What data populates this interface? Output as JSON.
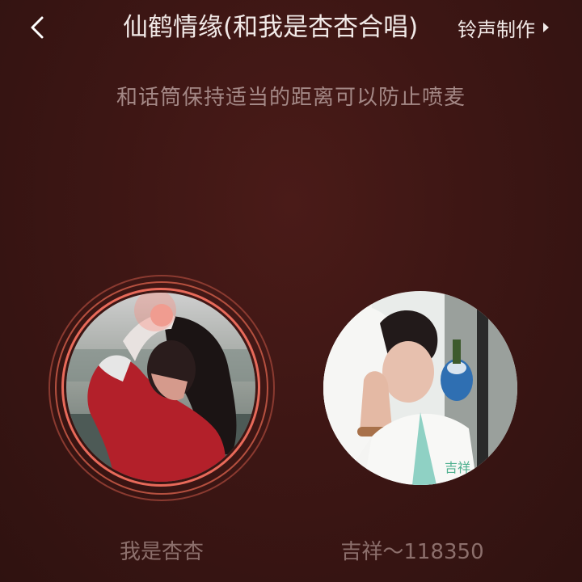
{
  "header": {
    "back_icon": "chevron-left-icon",
    "song_title": "仙鹤情缘(和我是杏杏合唱)",
    "ringtone_label": "铃声制作",
    "ringtone_icon": "triangle-right-icon"
  },
  "tip": "和话筒保持适当的距离可以防止喷麦",
  "singers": [
    {
      "name": "我是杏杏",
      "active": true
    },
    {
      "name": "吉祥～118350",
      "active": false,
      "photo_caption": "吉祥"
    }
  ],
  "colors": {
    "ring": "#c85a4c",
    "accent": "#e86a5a",
    "background": "#3d1614"
  }
}
